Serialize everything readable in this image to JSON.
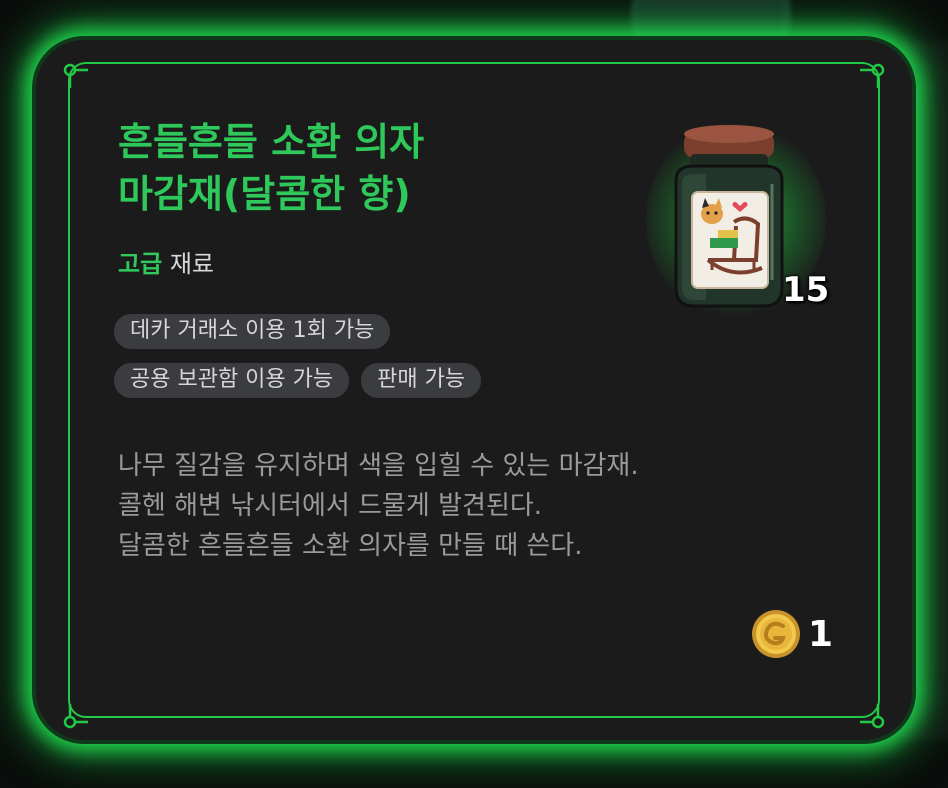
{
  "item": {
    "name": "흔들흔들 소환 의자\n마감재(달콤한 향)",
    "grade": "고급",
    "kind": "재료",
    "count": "15",
    "icon": "varnish-jar-icon"
  },
  "tags": [
    [
      "데카 거래소 이용 1회 가능"
    ],
    [
      "공용 보관함 이용 가능",
      "판매 가능"
    ]
  ],
  "description": [
    "나무 질감을 유지하며 색을 입힐 수 있는 마감재.",
    "콜헨 해변 낚시터에서 드물게 발견된다.",
    "달콤한 흔들흔들 소환 의자를 만들 때 쓴다."
  ],
  "price": {
    "value": "1",
    "icon": "gold-coin-icon"
  },
  "colors": {
    "accent": "#2ec85b",
    "glow": "#1fd34c",
    "panel": "#1b1b1b"
  }
}
